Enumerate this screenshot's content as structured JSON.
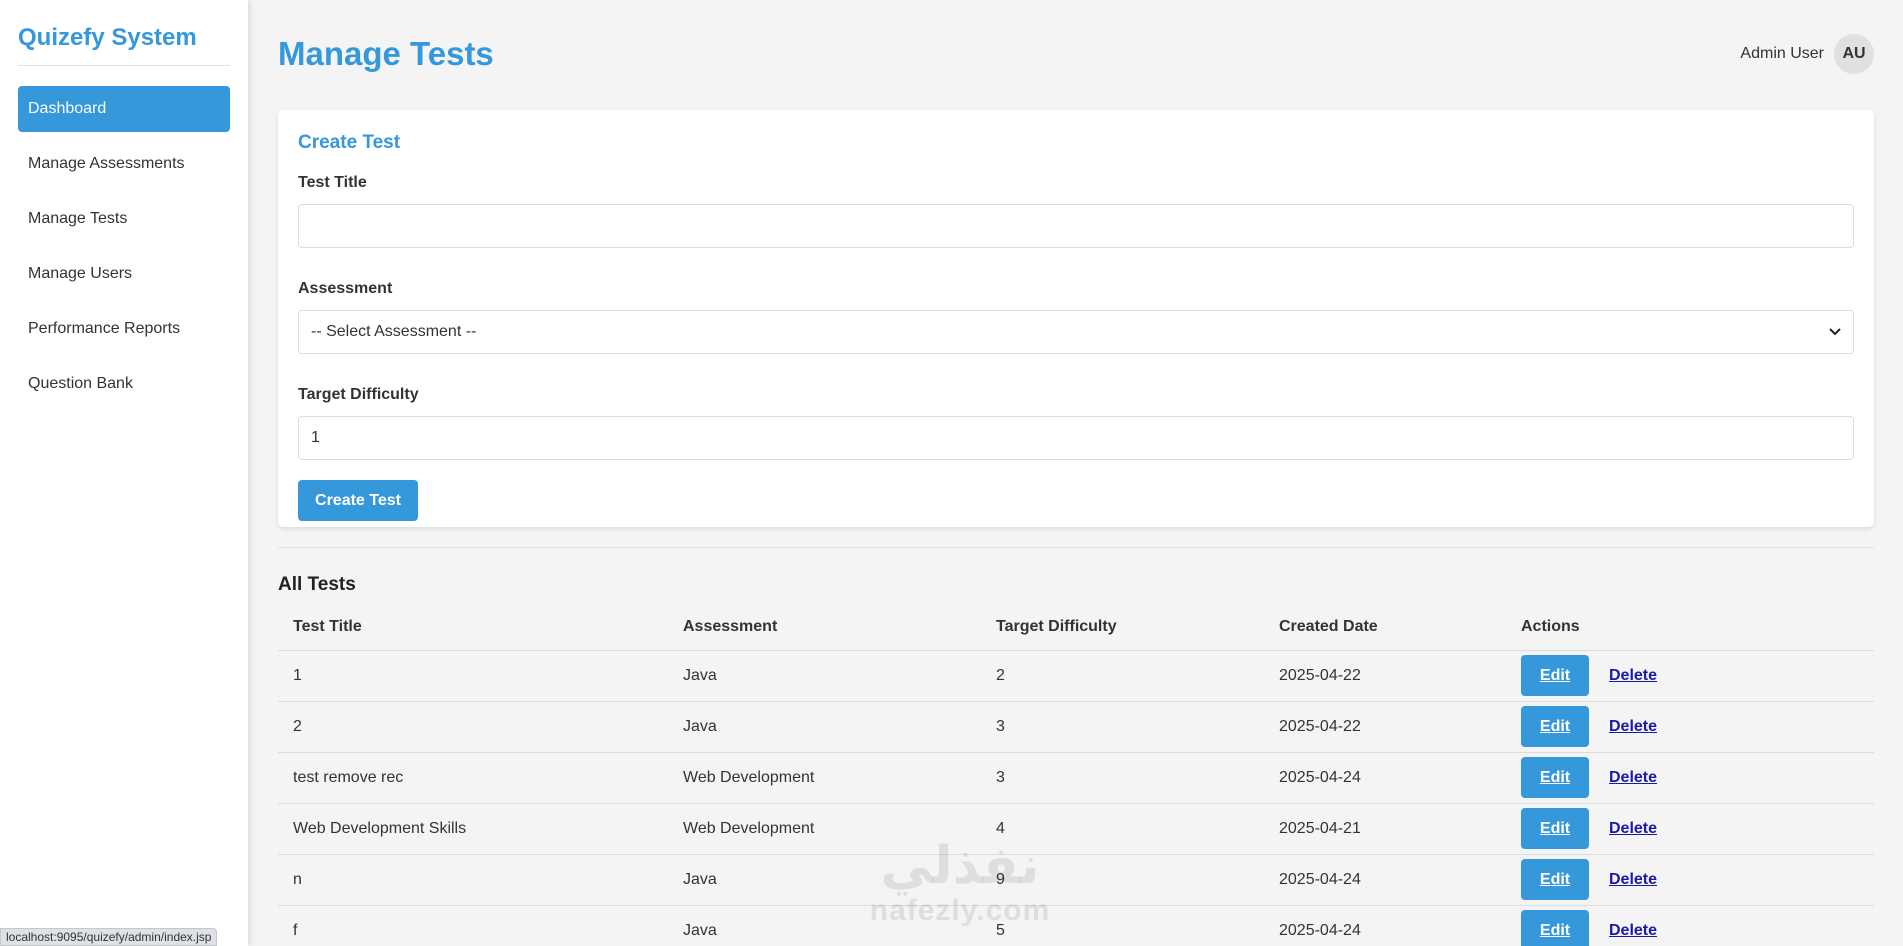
{
  "app": {
    "brand": "Quizefy System"
  },
  "sidebar": {
    "items": [
      {
        "label": "Dashboard",
        "active": true
      },
      {
        "label": "Manage Assessments"
      },
      {
        "label": "Manage Tests"
      },
      {
        "label": "Manage Users"
      },
      {
        "label": "Performance Reports"
      },
      {
        "label": "Question Bank"
      }
    ]
  },
  "header": {
    "title": "Manage Tests",
    "user_name": "Admin User",
    "avatar_initials": "AU"
  },
  "form": {
    "title": "Create Test",
    "test_title_label": "Test Title",
    "test_title_value": "",
    "assessment_label": "Assessment",
    "assessment_selected": "-- Select Assessment --",
    "difficulty_label": "Target Difficulty",
    "difficulty_value": "1",
    "submit_label": "Create Test"
  },
  "tests": {
    "title": "All Tests",
    "columns": [
      "Test Title",
      "Assessment",
      "Target Difficulty",
      "Created Date",
      "Actions"
    ],
    "edit_label": "Edit",
    "delete_label": "Delete",
    "rows": [
      [
        "1",
        "Java",
        "2",
        "2025-04-22"
      ],
      [
        "2",
        "Java",
        "3",
        "2025-04-22"
      ],
      [
        "test remove rec",
        "Web Development",
        "3",
        "2025-04-24"
      ],
      [
        "Web Development Skills",
        "Web Development",
        "4",
        "2025-04-21"
      ],
      [
        "n",
        "Java",
        "9",
        "2025-04-24"
      ],
      [
        "f",
        "Java",
        "5",
        "2025-04-24"
      ]
    ]
  },
  "status_bar": {
    "url": "localhost:9095/quizefy/admin/index.jsp"
  },
  "watermark": {
    "arabic": "نفذلي",
    "latin": "nafezly.com"
  },
  "colors": {
    "accent": "#3498db",
    "delete_link": "#1a1aa6"
  }
}
